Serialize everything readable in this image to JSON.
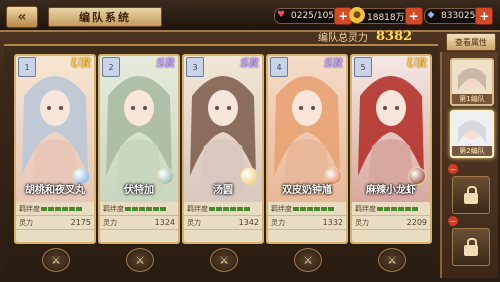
{
  "header": {
    "back_glyph": "«",
    "title": "编队系统"
  },
  "resources": [
    {
      "icon": "heart-icon",
      "value": "0225/105",
      "color": "#e94d6a"
    },
    {
      "icon": "coin-icon",
      "value": "18818万",
      "color": "#f5c242"
    },
    {
      "icon": "crystal-icon",
      "value": "833025",
      "color": "#8ab8f0"
    }
  ],
  "team_power": {
    "label": "编队总灵力",
    "value": "8382"
  },
  "attr_button": "查看属性",
  "stat_labels": {
    "bond": "羁绊度",
    "power": "灵力"
  },
  "cards": [
    {
      "badge": "1",
      "rarity": "UR",
      "name": "胡桃和夜叉丸",
      "power": "2175",
      "bond_level": 6,
      "palette": [
        "#f6e6d0",
        "#e8c6b8",
        "#b7c7d8"
      ],
      "orb": "#6ba8e8"
    },
    {
      "badge": "2",
      "rarity": "SR",
      "name": "伏特加",
      "power": "1324",
      "bond_level": 6,
      "palette": [
        "#e6ecdc",
        "#c8d6c0",
        "#a8b8a0"
      ],
      "orb": "#7aa8a0"
    },
    {
      "badge": "3",
      "rarity": "SR",
      "name": "汤圆",
      "power": "1342",
      "bond_level": 6,
      "palette": [
        "#f2e6d6",
        "#d8c8c0",
        "#7a5a4a"
      ],
      "orb": "#e8c86a"
    },
    {
      "badge": "4",
      "rarity": "SR",
      "name": "双皮奶钟馗",
      "power": "1332",
      "bond_level": 6,
      "palette": [
        "#f4dcc8",
        "#e8b898",
        "#e8a070"
      ],
      "orb": "#e0663a"
    },
    {
      "badge": "5",
      "rarity": "UR",
      "name": "麻辣小龙虾",
      "power": "2209",
      "bond_level": 6,
      "palette": [
        "#f4e8e4",
        "#d8a8a0",
        "#b02a22"
      ],
      "orb": "#8a2a1a"
    }
  ],
  "swap_glyph": "⚔",
  "side_panel": {
    "teams": [
      {
        "label": "第1编队",
        "active": false
      },
      {
        "label": "第2编队",
        "active": true
      }
    ],
    "locks": 2
  }
}
